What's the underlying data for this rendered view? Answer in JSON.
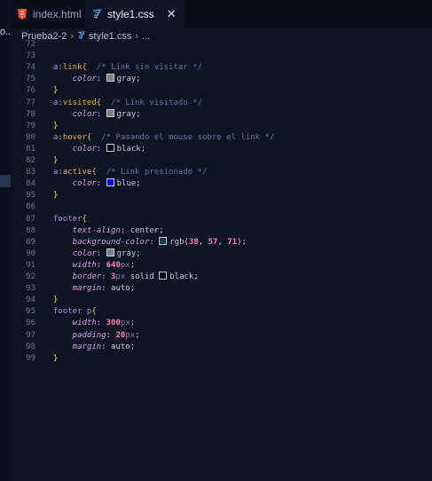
{
  "tabs": [
    {
      "label": "index.html",
      "active": false,
      "icon": "html-icon"
    },
    {
      "label": "style1.css",
      "active": true,
      "icon": "css-icon"
    }
  ],
  "left_fragment": "o...",
  "breadcrumb": {
    "folder": "Prueba2-2",
    "file": "style1.css",
    "rest": "..."
  },
  "lines": [
    {
      "n": "72",
      "parts": []
    },
    {
      "n": "73",
      "parts": []
    },
    {
      "n": "74",
      "parts": [
        [
          "sel-a",
          "a"
        ],
        [
          "sel",
          ":link{"
        ],
        [
          "cmt",
          "  /* Link sin visitar */"
        ]
      ]
    },
    {
      "n": "75",
      "parts": [
        [
          "val",
          "    "
        ],
        [
          "prop",
          "color"
        ],
        [
          "val",
          ": "
        ],
        [
          "sw",
          "#808080"
        ],
        [
          "val",
          "gray;"
        ]
      ]
    },
    {
      "n": "76",
      "parts": [
        [
          "br",
          "}"
        ]
      ]
    },
    {
      "n": "77",
      "parts": [
        [
          "sel-a",
          "a"
        ],
        [
          "sel",
          ":visited{"
        ],
        [
          "cmt",
          "  /* Link visitado */"
        ]
      ]
    },
    {
      "n": "78",
      "parts": [
        [
          "val",
          "    "
        ],
        [
          "prop",
          "color"
        ],
        [
          "val",
          ": "
        ],
        [
          "sw",
          "#808080"
        ],
        [
          "val",
          "gray;"
        ]
      ]
    },
    {
      "n": "79",
      "parts": [
        [
          "br",
          "}"
        ]
      ]
    },
    {
      "n": "80",
      "parts": [
        [
          "sel-a",
          "a"
        ],
        [
          "sel",
          ":hover{"
        ],
        [
          "cmt",
          "  /* Pasando el mouse sobre el link */"
        ]
      ]
    },
    {
      "n": "81",
      "parts": [
        [
          "val",
          "    "
        ],
        [
          "prop",
          "color"
        ],
        [
          "val",
          ": "
        ],
        [
          "sw",
          "#000000"
        ],
        [
          "val",
          "black;"
        ]
      ]
    },
    {
      "n": "82",
      "parts": [
        [
          "br",
          "}"
        ]
      ]
    },
    {
      "n": "83",
      "parts": [
        [
          "sel-a",
          "a"
        ],
        [
          "sel",
          ":active{"
        ],
        [
          "cmt",
          "  /* Link presionado */"
        ]
      ]
    },
    {
      "n": "84",
      "parts": [
        [
          "val",
          "    "
        ],
        [
          "prop",
          "color"
        ],
        [
          "val",
          ": "
        ],
        [
          "sw",
          "#0000ff"
        ],
        [
          "val",
          "blue;"
        ]
      ]
    },
    {
      "n": "85",
      "parts": [
        [
          "br",
          "}"
        ]
      ]
    },
    {
      "n": "86",
      "parts": []
    },
    {
      "n": "87",
      "parts": [
        [
          "sel-a",
          "footer"
        ],
        [
          "br",
          "{"
        ]
      ]
    },
    {
      "n": "88",
      "parts": [
        [
          "val",
          "    "
        ],
        [
          "prop",
          "text-align"
        ],
        [
          "val",
          ": center;"
        ]
      ]
    },
    {
      "n": "89",
      "parts": [
        [
          "val",
          "    "
        ],
        [
          "prop",
          "background-color"
        ],
        [
          "val",
          ": "
        ],
        [
          "sw",
          "#263947"
        ],
        [
          "val",
          "rgb("
        ],
        [
          "num",
          "38"
        ],
        [
          "val",
          ", "
        ],
        [
          "num",
          "57"
        ],
        [
          "val",
          ", "
        ],
        [
          "num",
          "71"
        ],
        [
          "val",
          ");"
        ]
      ]
    },
    {
      "n": "90",
      "parts": [
        [
          "val",
          "    "
        ],
        [
          "prop",
          "color"
        ],
        [
          "val",
          ": "
        ],
        [
          "sw",
          "#808080"
        ],
        [
          "val",
          "gray;"
        ]
      ]
    },
    {
      "n": "91",
      "parts": [
        [
          "val",
          "    "
        ],
        [
          "prop",
          "width"
        ],
        [
          "val",
          ": "
        ],
        [
          "num",
          "640"
        ],
        [
          "unit",
          "px"
        ],
        [
          "val",
          ";"
        ]
      ]
    },
    {
      "n": "92",
      "parts": [
        [
          "val",
          "    "
        ],
        [
          "prop",
          "border"
        ],
        [
          "val",
          ": "
        ],
        [
          "num",
          "3"
        ],
        [
          "unit",
          "px"
        ],
        [
          "val",
          " solid "
        ],
        [
          "sw",
          "#000000"
        ],
        [
          "val",
          "black;"
        ]
      ]
    },
    {
      "n": "93",
      "parts": [
        [
          "val",
          "    "
        ],
        [
          "prop",
          "margin"
        ],
        [
          "val",
          ": auto;"
        ]
      ]
    },
    {
      "n": "94",
      "parts": [
        [
          "br",
          "}"
        ]
      ]
    },
    {
      "n": "95",
      "parts": [
        [
          "sel-a",
          "footer p"
        ],
        [
          "br",
          "{"
        ]
      ]
    },
    {
      "n": "96",
      "parts": [
        [
          "val",
          "    "
        ],
        [
          "prop",
          "width"
        ],
        [
          "val",
          ": "
        ],
        [
          "num",
          "300"
        ],
        [
          "unit",
          "px"
        ],
        [
          "val",
          ";"
        ]
      ]
    },
    {
      "n": "97",
      "parts": [
        [
          "val",
          "    "
        ],
        [
          "prop",
          "padding"
        ],
        [
          "val",
          ": "
        ],
        [
          "num",
          "20"
        ],
        [
          "unit",
          "px"
        ],
        [
          "val",
          ";"
        ]
      ]
    },
    {
      "n": "98",
      "parts": [
        [
          "val",
          "    "
        ],
        [
          "prop",
          "margin"
        ],
        [
          "val",
          ": auto;"
        ]
      ]
    },
    {
      "n": "99",
      "parts": [
        [
          "br",
          "}"
        ]
      ]
    }
  ]
}
